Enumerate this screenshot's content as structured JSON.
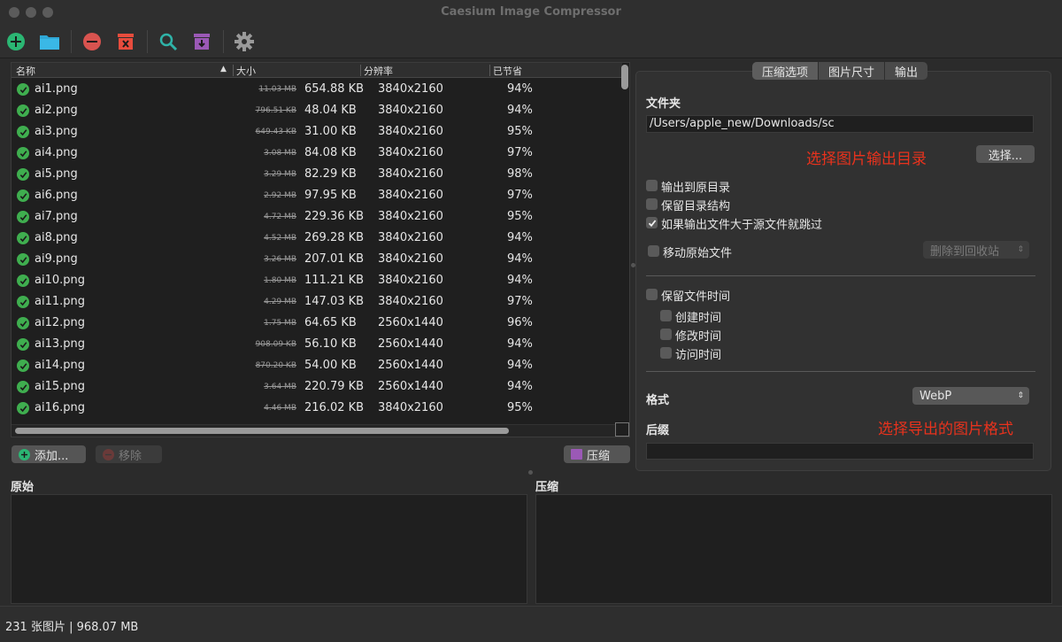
{
  "window": {
    "title": "Caesium Image Compressor"
  },
  "toolbar": {
    "buttons": [
      {
        "name": "add-icon",
        "color": "#2bb673"
      },
      {
        "name": "folder-icon",
        "color": "#2fa7d6"
      },
      {
        "name": "remove-icon",
        "color": "#d9534f"
      },
      {
        "name": "clear-icon",
        "color": "#e84c3d"
      },
      {
        "name": "search-icon",
        "color": "#2fb3a8"
      },
      {
        "name": "import-icon",
        "color": "#9b59b6"
      },
      {
        "name": "gear-icon",
        "color": "#9a9a9a"
      }
    ]
  },
  "table": {
    "columns": {
      "name": "名称",
      "size": "大小",
      "resolution": "分辨率",
      "saved": "已节省"
    },
    "rows": [
      {
        "name": "ai1.png",
        "old": "11.03 MB",
        "new": "654.88 KB",
        "res": "3840x2160",
        "saved": "94%"
      },
      {
        "name": "ai2.png",
        "old": "796.51 KB",
        "new": "48.04 KB",
        "res": "3840x2160",
        "saved": "94%"
      },
      {
        "name": "ai3.png",
        "old": "649.43 KB",
        "new": "31.00 KB",
        "res": "3840x2160",
        "saved": "95%"
      },
      {
        "name": "ai4.png",
        "old": "3.08 MB",
        "new": "84.08 KB",
        "res": "3840x2160",
        "saved": "97%"
      },
      {
        "name": "ai5.png",
        "old": "3.29 MB",
        "new": "82.29 KB",
        "res": "3840x2160",
        "saved": "98%"
      },
      {
        "name": "ai6.png",
        "old": "2.92 MB",
        "new": "97.95 KB",
        "res": "3840x2160",
        "saved": "97%"
      },
      {
        "name": "ai7.png",
        "old": "4.72 MB",
        "new": "229.36 KB",
        "res": "3840x2160",
        "saved": "95%"
      },
      {
        "name": "ai8.png",
        "old": "4.52 MB",
        "new": "269.28 KB",
        "res": "3840x2160",
        "saved": "94%"
      },
      {
        "name": "ai9.png",
        "old": "3.26 MB",
        "new": "207.01 KB",
        "res": "3840x2160",
        "saved": "94%"
      },
      {
        "name": "ai10.png",
        "old": "1.80 MB",
        "new": "111.21 KB",
        "res": "3840x2160",
        "saved": "94%"
      },
      {
        "name": "ai11.png",
        "old": "4.29 MB",
        "new": "147.03 KB",
        "res": "3840x2160",
        "saved": "97%"
      },
      {
        "name": "ai12.png",
        "old": "1.75 MB",
        "new": "64.65 KB",
        "res": "2560x1440",
        "saved": "96%"
      },
      {
        "name": "ai13.png",
        "old": "908.09 KB",
        "new": "56.10 KB",
        "res": "2560x1440",
        "saved": "94%"
      },
      {
        "name": "ai14.png",
        "old": "870.20 KB",
        "new": "54.00 KB",
        "res": "2560x1440",
        "saved": "94%"
      },
      {
        "name": "ai15.png",
        "old": "3.64 MB",
        "new": "220.79 KB",
        "res": "2560x1440",
        "saved": "94%"
      },
      {
        "name": "ai16.png",
        "old": "4.46 MB",
        "new": "216.02 KB",
        "res": "3840x2160",
        "saved": "95%"
      }
    ]
  },
  "list_buttons": {
    "add": "添加...",
    "remove": "移除",
    "compress": "压缩"
  },
  "panel": {
    "tabs": [
      "压缩选项",
      "图片尺寸",
      "输出"
    ],
    "folder_label": "文件夹",
    "folder_path": "/Users/apple_new/Downloads/sc",
    "annotation_dir": "选择图片输出目录",
    "choose_button": "选择...",
    "output_to_source": "输出到原目录",
    "keep_structure": "保留目录结构",
    "skip_if_larger": "如果输出文件大于源文件就跳过",
    "move_original": "移动原始文件",
    "move_target": "删除到回收站",
    "keep_dates": "保留文件时间",
    "created": "创建时间",
    "modified": "修改时间",
    "accessed": "访问时间",
    "format_label": "格式",
    "format_value": "WebP",
    "annotation_format": "选择导出的图片格式",
    "suffix_label": "后缀",
    "suffix_value": ""
  },
  "preview": {
    "original": "原始",
    "compressed": "压缩"
  },
  "status": {
    "text": "231 张图片 | 968.07 MB"
  }
}
